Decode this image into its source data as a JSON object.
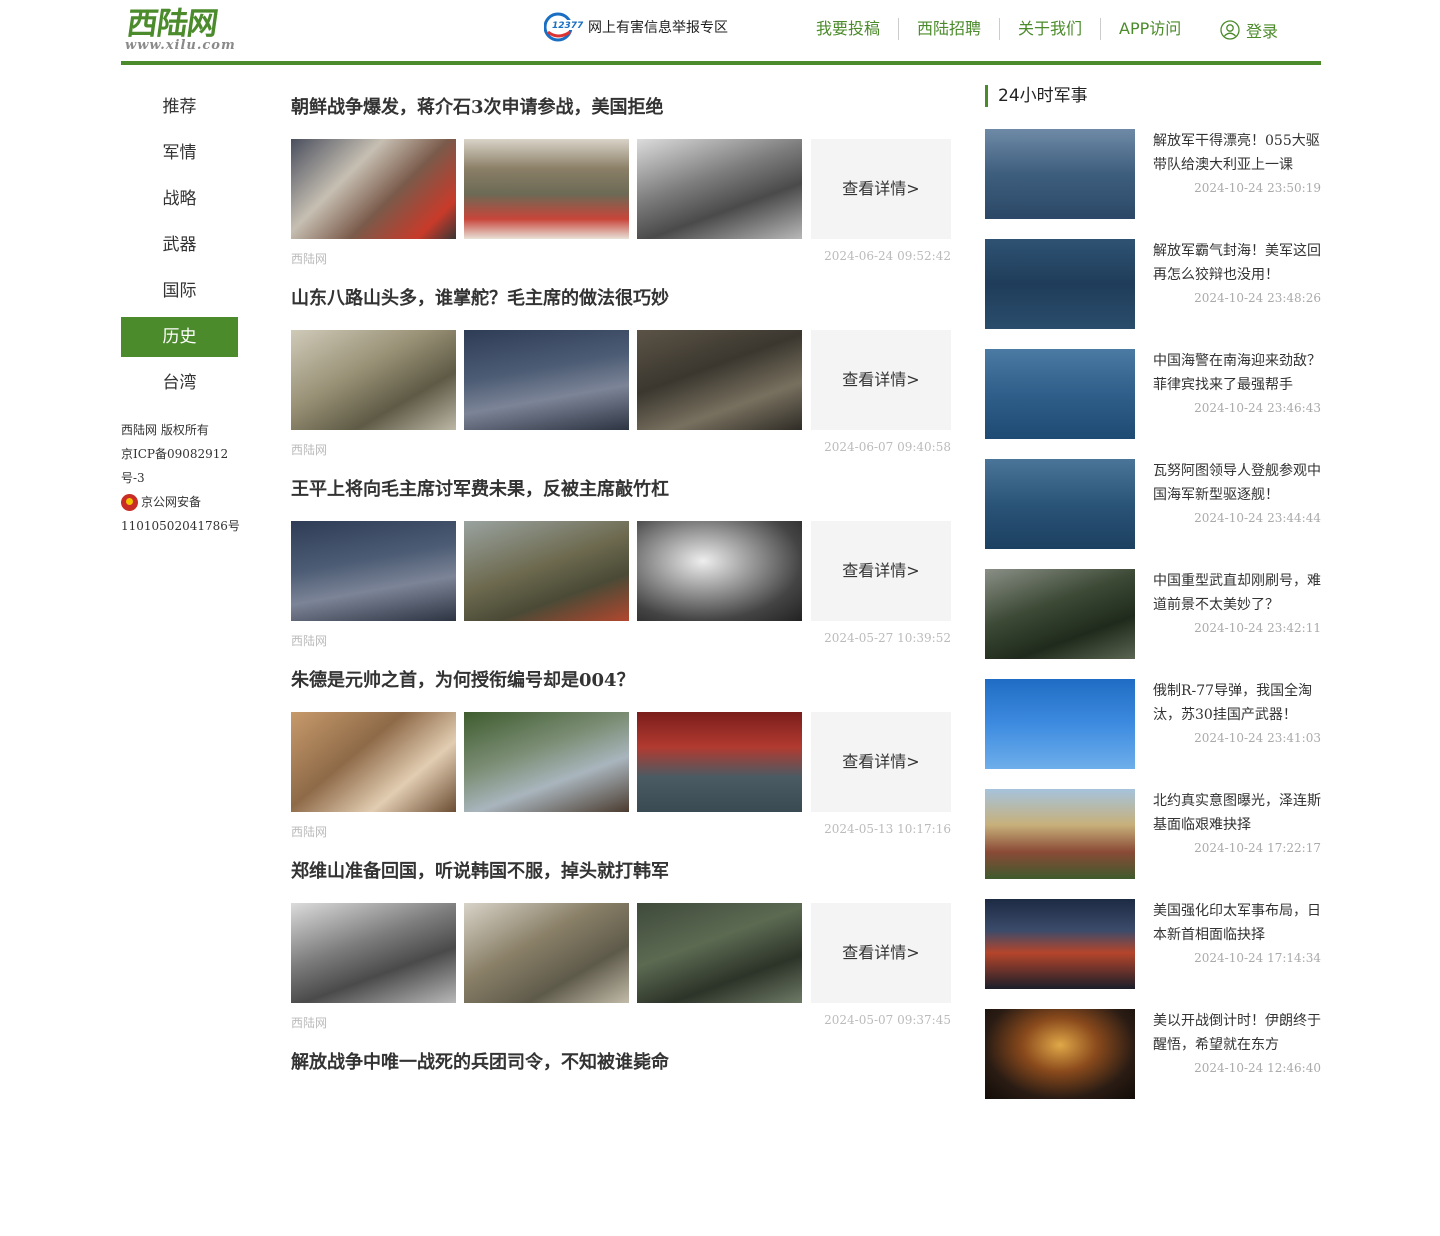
{
  "header": {
    "logo_text": "西陆网",
    "logo_sub": "www.xilu.com",
    "report_text": "网上有害信息举报专区",
    "report_badge": "12377",
    "nav": [
      "我要投稿",
      "西陆招聘",
      "关于我们",
      "APP访问"
    ],
    "login": "登录"
  },
  "leftnav": [
    "推荐",
    "军情",
    "战略",
    "武器",
    "国际",
    "历史",
    "台湾"
  ],
  "leftnav_active": "历史",
  "copyright": {
    "line1": "西陆网  版权所有",
    "line2": "京ICP备09082912号-3",
    "line3": "京公网安备",
    "line4": "11010502041786号"
  },
  "articles": [
    {
      "title": "朝鲜战争爆发，蒋介石3次申请参战，美国拒绝",
      "more": "查看详情>",
      "source": "西陆网",
      "date": "2024-06-24 09:52:42"
    },
    {
      "title": "山东八路山头多，谁掌舵？毛主席的做法很巧妙",
      "more": "查看详情>",
      "source": "西陆网",
      "date": "2024-06-07 09:40:58"
    },
    {
      "title": "王平上将向毛主席讨军费未果，反被主席敲竹杠",
      "more": "查看详情>",
      "source": "西陆网",
      "date": "2024-05-27 10:39:52"
    },
    {
      "title": "朱德是元帅之首，为何授衔编号却是004？",
      "more": "查看详情>",
      "source": "西陆网",
      "date": "2024-05-13 10:17:16"
    },
    {
      "title": "郑维山准备回国，听说韩国不服，掉头就打韩军",
      "more": "查看详情>",
      "source": "西陆网",
      "date": "2024-05-07 09:37:45"
    },
    {
      "title": "解放战争中唯一战死的兵团司令，不知被谁毙命",
      "more": "",
      "source": "",
      "date": ""
    }
  ],
  "sidebar": {
    "title": "24小时军事",
    "items": [
      {
        "title": "解放军干得漂亮！055大驱带队给澳大利亚上一课",
        "date": "2024-10-24 23:50:19"
      },
      {
        "title": "解放军霸气封海！美军这回再怎么狡辩也没用！",
        "date": "2024-10-24 23:48:26"
      },
      {
        "title": "中国海警在南海迎来劲敌？菲律宾找来了最强帮手",
        "date": "2024-10-24 23:46:43"
      },
      {
        "title": "瓦努阿图领导人登舰参观中国海军新型驱逐舰！",
        "date": "2024-10-24 23:44:44"
      },
      {
        "title": "中国重型武直却刚刷号，难道前景不太美妙了？",
        "date": "2024-10-24 23:42:11"
      },
      {
        "title": "俄制R-77导弹，我国全淘汰，苏30挂国产武器！",
        "date": "2024-10-24 23:41:03"
      },
      {
        "title": "北约真实意图曝光，泽连斯基面临艰难抉择",
        "date": "2024-10-24 17:22:17"
      },
      {
        "title": "美国强化印太军事布局，日本新首相面临抉择",
        "date": "2024-10-24 17:14:34"
      },
      {
        "title": "美以开战倒计时！伊朗终于醒悟，希望就在东方",
        "date": "2024-10-24 12:46:40"
      }
    ]
  }
}
